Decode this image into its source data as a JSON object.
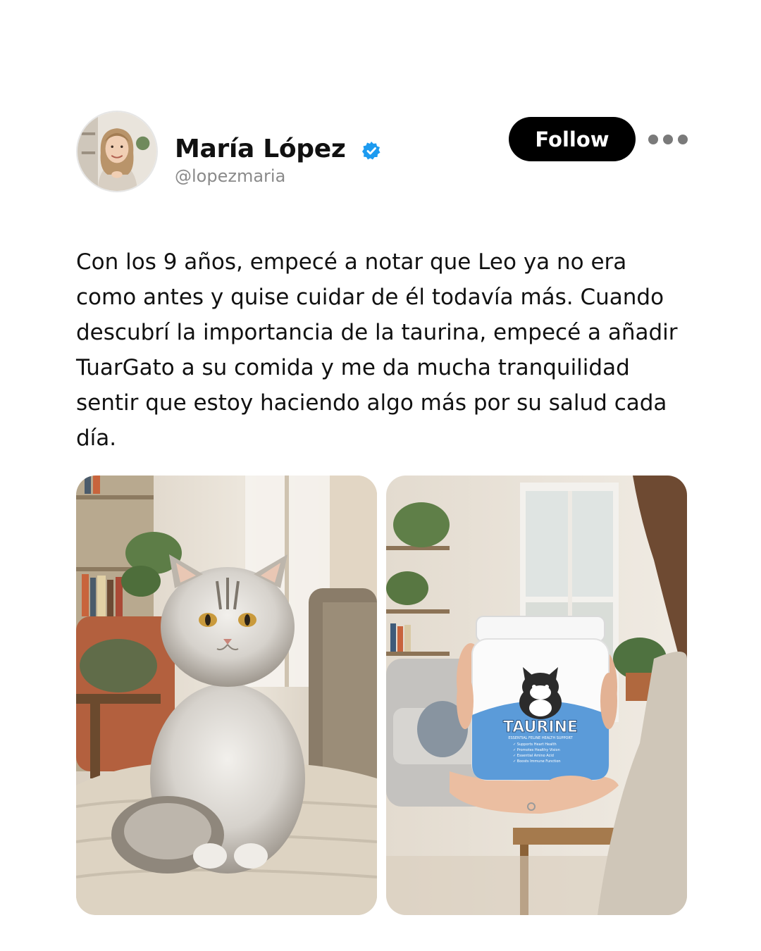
{
  "author": {
    "name": "María López",
    "handle": "@lopezmaria",
    "verified": true,
    "avatar_icon": "profile-photo"
  },
  "actions": {
    "follow_label": "Follow",
    "more_icon": "more-horizontal-icon"
  },
  "post": {
    "text": "Con los 9 años, empecé a notar que Leo ya no era como antes y quise cuidar de él todavía más. Cuando descubrí la importancia de la taurina, empecé a añadir TuarGato a su comida y me da mucha tranquilidad sentir que estoy haciendo algo más por su salud cada día."
  },
  "media": {
    "product": {
      "label_title": "TAURINE",
      "label_subtitle": "ESSENTIAL FELINE HEALTH SUPPORT",
      "bullets": [
        "✓ Supports Heart Health",
        "✓ Promotes Healthy Vision",
        "✓ Essential Amino Acid",
        "✓ Boosts Immune Function"
      ]
    }
  },
  "colors": {
    "follow_bg": "#000000",
    "verified_blue": "#1d9bf0",
    "label_blue": "#5b9bd9"
  }
}
